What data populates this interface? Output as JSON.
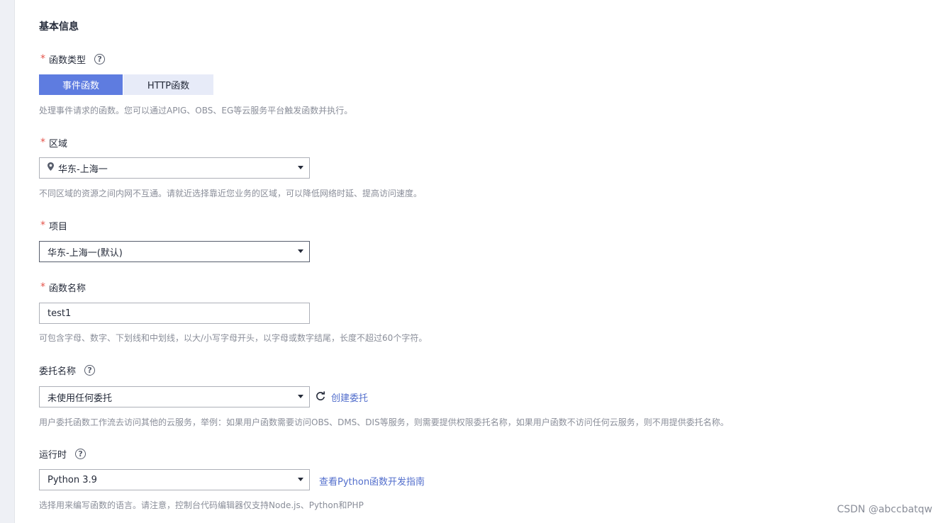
{
  "section": {
    "title": "基本信息"
  },
  "function_type": {
    "label": "函数类型",
    "required": "*",
    "help_icon": "question-circle-icon",
    "options": [
      "事件函数",
      "HTTP函数"
    ],
    "selected": "事件函数",
    "hint": "处理事件请求的函数。您可以通过APIG、OBS、EG等云服务平台触发函数并执行。"
  },
  "region": {
    "label": "区域",
    "required": "*",
    "icon": "location-pin-icon",
    "value": "华东-上海一",
    "hint": "不同区域的资源之间内网不互通。请就近选择靠近您业务的区域，可以降低网络时延、提高访问速度。"
  },
  "project": {
    "label": "项目",
    "required": "*",
    "value": "华东-上海一(默认)"
  },
  "function_name": {
    "label": "函数名称",
    "required": "*",
    "value": "test1",
    "hint": "可包含字母、数字、下划线和中划线，以大/小写字母开头，以字母或数字结尾，长度不超过60个字符。"
  },
  "agency": {
    "label": "委托名称",
    "help_icon": "question-circle-icon",
    "value": "未使用任何委托",
    "refresh_icon": "refresh-icon",
    "create_link": "创建委托",
    "hint": "用户委托函数工作流去访问其他的云服务，举例：如果用户函数需要访问OBS、DMS、DIS等服务，则需要提供权限委托名称，如果用户函数不访问任何云服务，则不用提供委托名称。"
  },
  "runtime": {
    "label": "运行时",
    "help_icon": "question-circle-icon",
    "value": "Python 3.9",
    "guide_link": "查看Python函数开发指南",
    "hint": "选择用来编写函数的语言。请注意，控制台代码编辑器仅支持Node.js、Python和PHP"
  },
  "watermark": "CSDN @abccbatqw",
  "colors": {
    "primary": "#5e7ce0",
    "link": "#526ecc",
    "required": "#e5544b",
    "hint": "#8a8e99"
  }
}
